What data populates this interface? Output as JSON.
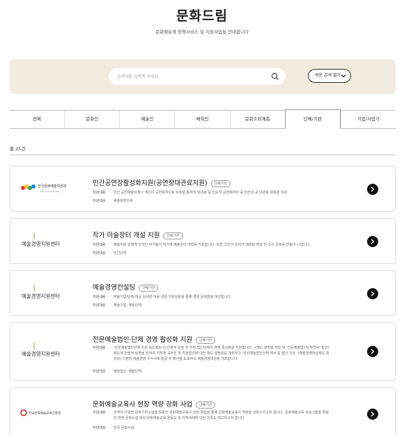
{
  "header": {
    "title": "문화드림",
    "subtitle": "문화예술계 정책서비스 및 지원사업을 안내합니다"
  },
  "search": {
    "placeholder": "검색어를 입력해 주세요.",
    "quick_button": "쉬운 검색 열기"
  },
  "tabs": [
    {
      "label": "전체",
      "active": false
    },
    {
      "label": "문화인",
      "active": false
    },
    {
      "label": "예술인",
      "active": false
    },
    {
      "label": "체육인",
      "active": false
    },
    {
      "label": "문화소외계층",
      "active": false
    },
    {
      "label": "단체/기관",
      "active": true
    },
    {
      "label": "기업/사업가",
      "active": false
    }
  ],
  "total": "총 25건",
  "cards": [
    {
      "title": "민간공연장활성화지원(공연장대관료지원)",
      "badge": "단체/기관",
      "logo_text": "한국문화예술위원회",
      "logo_sub": "Arts Council Korea",
      "rows": [
        {
          "k": "지원내용",
          "v": "민간 공연예술단체나 개인이 공연목적으로 저촉을 통하여 임대료 등 입도적 공연제작비 중 민간의 공 대관료 항목을 지원"
        },
        {
          "k": "지원대상",
          "v": "예술관련단체"
        }
      ]
    },
    {
      "title": "작가 미술장터 개설 지원",
      "badge": "단체/기관",
      "logo_text": "예술경영지원센터",
      "logo_sub": "",
      "rows": [
        {
          "k": "지원내용",
          "v": "예술지원 관점에 마약한 작가들의 작가에 예술원이 개최를 지원합니다. 또한 국민의 유저가 예술을 향상 및 소유 문화를 만들어 나갑니다."
        },
        {
          "k": "지원대상",
          "v": "민간단체"
        }
      ]
    },
    {
      "title": "예술경영컨설팅",
      "badge": "단체/기관",
      "logo_text": "예술경영지원센터",
      "logo_sub": "",
      "rows": [
        {
          "k": "지원내용",
          "v": "예술기업/단체 대상 상세한 이용 경영 지원상담를 통해 경영 문제점을 개선합니다."
        },
        {
          "k": "지원대상",
          "v": "예술기업, 예술단체"
        }
      ]
    },
    {
      "title": "전문예술법인·단체 경영 활성화 지원",
      "badge": "단체/기관",
      "logo_text": "예술경영지원센터",
      "logo_sub": "",
      "rows": [
        {
          "k": "지원내용",
          "v": "'전문예술법인단체 지원 육성제도'의 안정적 운영 및 지정 법인단체의 경영 활성화를 지원합니다. -(제도 설명회 개최 및 '전문예술법인단체백서' 발간) 제도에 안정적 운영을 위하여 지자체 공무원 및 지원법인에 대한 제도 설명회를 개최하고 '전문예술법인단체 백서'를 발간 지원 -(예술경영대상제도 활성화) 다양한 예술경영 우수사례 발굴 및 확산을 도모하고 예술경영대상을 개최합니다."
        },
        {
          "k": "지원대상",
          "v": "예술법인, 예술단체"
        }
      ]
    },
    {
      "title": "문화예술교육사 현장 역량 강화 사업",
      "badge": "단체/기관",
      "logo_text": "한국문화예술교육진흥원",
      "logo_sub": "",
      "rows": [
        {
          "k": "지원내용",
          "v": "지역의 다양한 문화기반시설을 활용한 문화예술교육사 성장 경험을 통해 문화예술교육사 역량을 강화시키고자 합니다. 문화예술교육 프로그램을 활용한 현장 문화시설 대상 문화예술교육 활동도 및 전체과제에 대한 만족도 제고하고자 합니다."
        },
        {
          "k": "지원대상",
          "v": "전국 문화시설"
        }
      ]
    }
  ],
  "colors": {
    "search_bg": "#f2ebe0",
    "arrow_button": "#111111"
  }
}
